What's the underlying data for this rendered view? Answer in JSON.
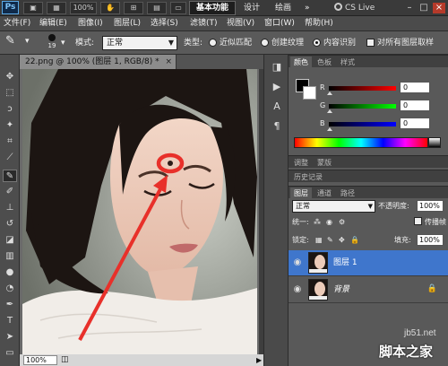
{
  "app": {
    "logo": "Ps",
    "zoom": "100%",
    "workspaces": {
      "basic": "基本功能",
      "design": "设计",
      "painting": "绘画"
    },
    "cs_live": "CS Live",
    "window_controls": {
      "minimize": "–",
      "restore": "□",
      "close": "×"
    }
  },
  "menu": [
    "文件(F)",
    "编辑(E)",
    "图像(I)",
    "图层(L)",
    "选择(S)",
    "滤镜(T)",
    "视图(V)",
    "窗口(W)",
    "帮助(H)"
  ],
  "options": {
    "brush_size": "19",
    "mode_label": "模式:",
    "mode_value": "正常",
    "type_label": "类型:",
    "radio_proximity": "近似匹配",
    "radio_texture": "创建纹理",
    "radio_content": "内容识别",
    "checkbox_all_layers": "对所有图层取样"
  },
  "document": {
    "tab_title": "22.png @ 100% (图层 1, RGB/8) *",
    "tab_close": "×",
    "zoom_status": "100%"
  },
  "color_panel": {
    "tabs": [
      "颜色",
      "色板",
      "样式"
    ],
    "r_label": "R",
    "g_label": "G",
    "b_label": "B",
    "r_value": "0",
    "g_value": "0",
    "b_value": "0"
  },
  "adjust_tabs": [
    "调整",
    "蒙版"
  ],
  "history_tab": "历史记录",
  "layers_panel": {
    "tabs": [
      "图层",
      "通道",
      "路径"
    ],
    "blend_mode": "正常",
    "opacity_label": "不透明度:",
    "opacity_value": "100%",
    "unify_label": "统一:",
    "propagate_label": "传播帧",
    "lock_label": "锁定:",
    "fill_label": "填充:",
    "fill_value": "100%",
    "layers": [
      {
        "name": "图层 1",
        "selected": true
      },
      {
        "name": "背景",
        "selected": false
      }
    ]
  },
  "watermark": {
    "site": "jb51.net",
    "name": "脚本之家"
  },
  "colors": {
    "selection": "#3f76cc",
    "annotation": "#e8302a"
  }
}
